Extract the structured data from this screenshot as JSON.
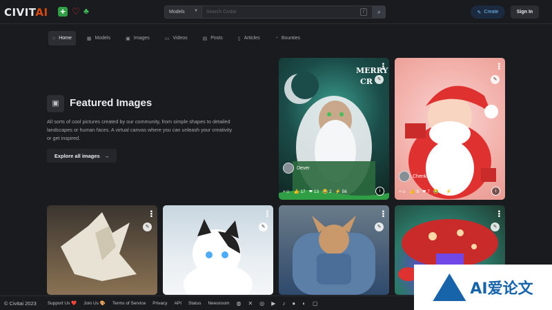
{
  "header": {
    "logo_main": "CIVIT",
    "logo_accent": "AI",
    "plus_glyph": "+",
    "heart_glyph": "♡",
    "bell_glyph": "🔔",
    "search": {
      "scope_value": "Models",
      "placeholder": "Search Civitai",
      "shortcut": "/"
    },
    "create_label": "Create",
    "signin_label": "Sign In"
  },
  "nav": {
    "items": [
      {
        "label": "Home",
        "icon": "home-icon",
        "glyph": "⌂"
      },
      {
        "label": "Models",
        "icon": "models-icon",
        "glyph": "▦"
      },
      {
        "label": "Images",
        "icon": "images-icon",
        "glyph": "▣"
      },
      {
        "label": "Videos",
        "icon": "videos-icon",
        "glyph": "▭"
      },
      {
        "label": "Posts",
        "icon": "posts-icon",
        "glyph": "▤"
      },
      {
        "label": "Articles",
        "icon": "articles-icon",
        "glyph": "▯"
      },
      {
        "label": "Bounties",
        "icon": "bounties-icon",
        "glyph": "◔"
      }
    ]
  },
  "featured": {
    "title": "Featured Images",
    "description": "All sorts of cool pictures created by our community, from simple shapes to detailed landscapes or human faces. A virtual canvas where you can unleash your creativity or get inspired.",
    "explore_label": "Explore all images",
    "explore_arrow": "→"
  },
  "cards": {
    "wizard": {
      "user": "Dever",
      "reactions": {
        "like": "17",
        "heart": "13",
        "laugh": "2",
        "buzz": "56"
      }
    },
    "santa": {
      "user": "Chenkin",
      "reactions": {
        "like": "9",
        "heart": "7",
        "laugh": "4",
        "buzz": "0"
      }
    }
  },
  "footer": {
    "copyright": "© Civitai 2023",
    "links": [
      "Support Us ❤️",
      "Join Us 🎨",
      "Terms of Service",
      "Privacy",
      "API",
      "Status",
      "Newsroom"
    ],
    "social_icons": [
      "discord-icon",
      "x-icon",
      "instagram-icon",
      "youtube-icon",
      "tiktok-icon",
      "reddit-icon",
      "github-icon",
      "chat-icon"
    ]
  },
  "ad": {
    "text": "AI爱论文"
  },
  "colors": {
    "background": "#1a1b1e",
    "accent_blue": "#74c0fc",
    "logo_accent": "#d9480f",
    "plus_green": "#2f9e44"
  }
}
